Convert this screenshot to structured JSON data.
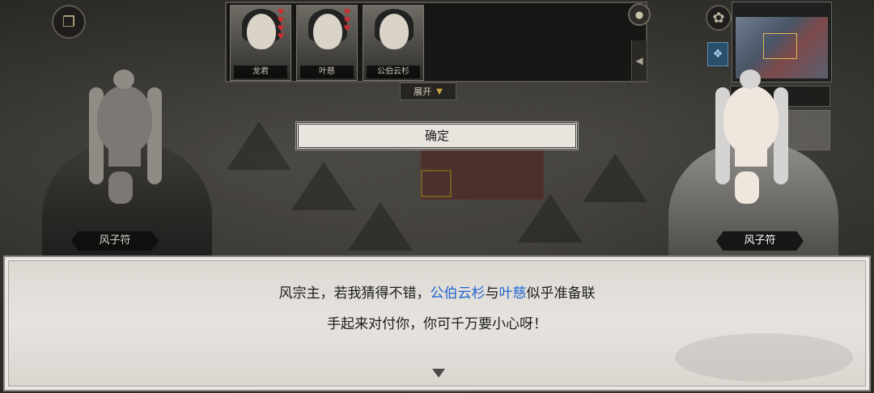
{
  "party": {
    "heroes": [
      {
        "name": "龙君",
        "hearts": 4
      },
      {
        "name": "叶慈",
        "hearts": 3
      },
      {
        "name": "公伯云杉",
        "hearts": 0
      }
    ],
    "expand_label": "展开"
  },
  "confirm_label": "确定",
  "speaker_left": "风子符",
  "speaker_right": "风子符",
  "dialogue": {
    "l1_a": "风宗主，若我猜得不错，",
    "l1_name1": "公伯云杉",
    "l1_mid": "与",
    "l1_name2": "叶慈",
    "l1_end": "似乎准备联",
    "l2": "手起来对付你，你可千万要小心呀！"
  },
  "colors": {
    "highlight_name": "#1e63d1",
    "dialog_bg": "#e6e3de"
  },
  "icons": {
    "scroll": "scroll-icon",
    "gear": "gear-icon",
    "book": "book-icon",
    "next": "next-arrow-icon"
  }
}
